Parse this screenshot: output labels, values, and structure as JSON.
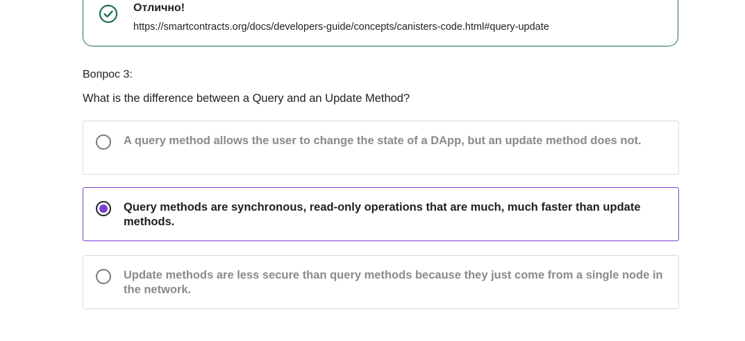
{
  "feedback": {
    "title": "Отлично!",
    "link": "https://smartcontracts.org/docs/developers-guide/concepts/canisters-code.html#query-update",
    "icon": "check-circle-icon",
    "color": "#1f6f4a"
  },
  "question": {
    "number_label": "Вопрос 3:",
    "text": "What is the difference between a Query and an Update Method?"
  },
  "options": [
    {
      "label": "A query method allows the user to change the state of a DApp, but an update method does not.",
      "selected": false
    },
    {
      "label": "Query methods are synchronous, read-only operations that are much, much faster than update methods.",
      "selected": true
    },
    {
      "label": "Update methods are less secure than query methods because they just come from a single node in the network.",
      "selected": false
    }
  ],
  "colors": {
    "accent": "#7b3fd1",
    "success": "#1f6f4a",
    "muted_text": "#8a8a8a",
    "border": "#dcdcdc"
  }
}
